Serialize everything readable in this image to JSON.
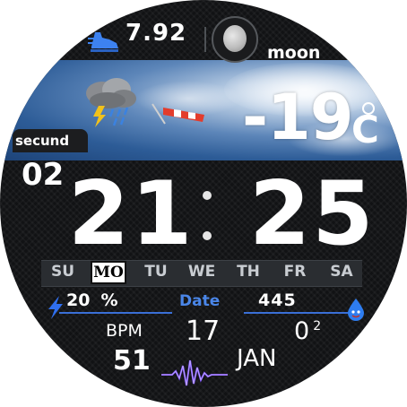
{
  "steps": {
    "value": "7.92",
    "icon": "running-shoe-icon"
  },
  "moon": {
    "label": "moon",
    "icon": "moon-phase-icon"
  },
  "weather": {
    "temperature": "-19",
    "unit": "C",
    "icon": "thunderstorm-icon"
  },
  "seconds": {
    "label": "secund",
    "value": "02"
  },
  "time": {
    "hour": "21",
    "minute": "25"
  },
  "week": {
    "days": [
      "SU",
      "MO",
      "TU",
      "WE",
      "TH",
      "FR",
      "SA"
    ],
    "active": "MO"
  },
  "battery": {
    "value": "20",
    "unit": "%",
    "icon": "lightning-bolt-icon"
  },
  "date": {
    "label": "Date",
    "day": "17",
    "month": "JAN"
  },
  "water": {
    "value": "445",
    "icon": "water-drop-icon"
  },
  "heart": {
    "label": "BPM",
    "value": "51",
    "icon": "heartbeat-pulse-icon"
  },
  "oxygen": {
    "value": "0",
    "sup": "2"
  },
  "colors": {
    "accent": "#4a86e8",
    "underline": "#3a6fd6",
    "pulse": "#7b4dff"
  }
}
